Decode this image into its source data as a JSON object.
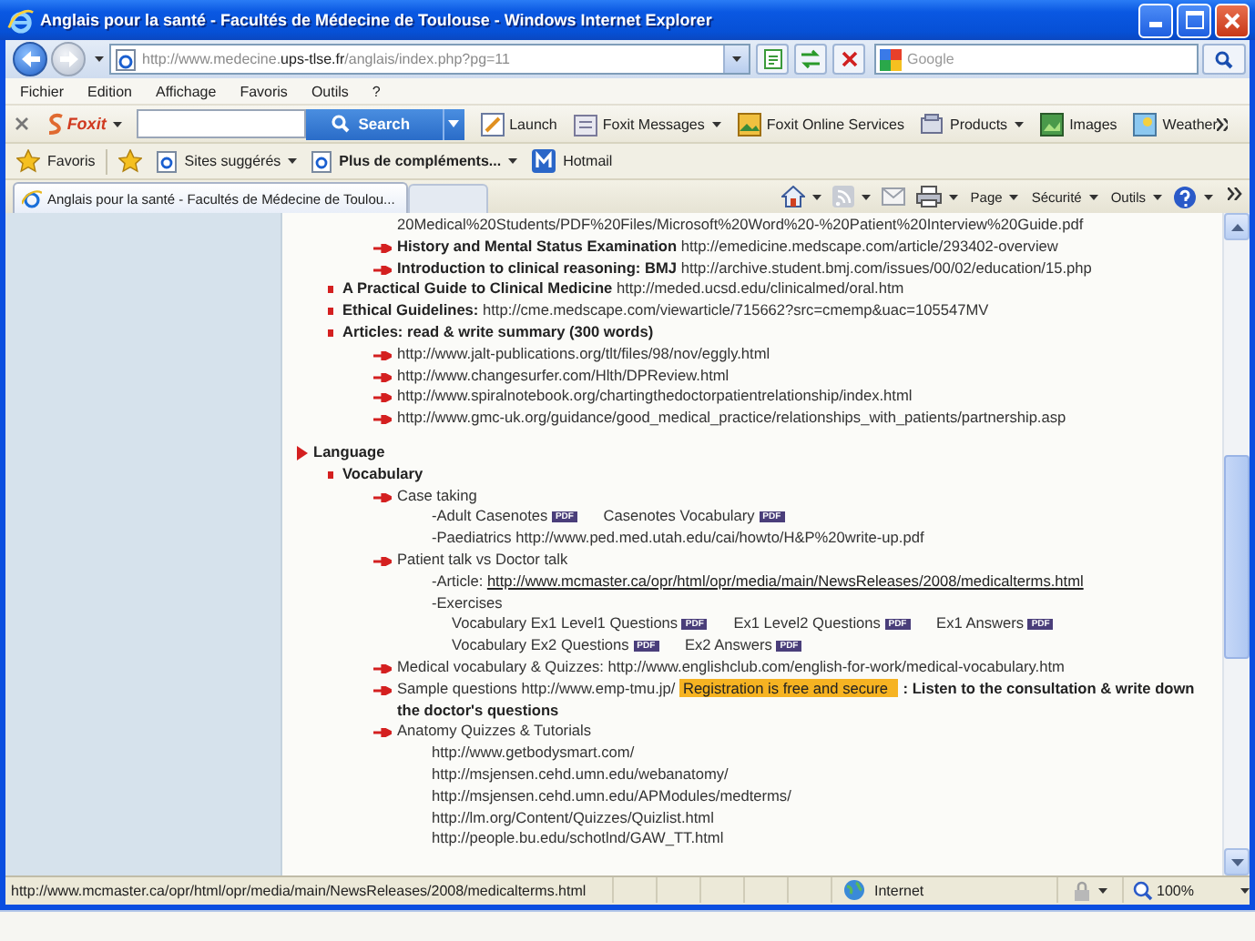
{
  "window": {
    "title": "Anglais pour la santé - Facultés de Médecine de Toulouse - Windows Internet Explorer"
  },
  "address_bar": {
    "url_parts": [
      "http://www.medecine.",
      "ups-tlse.fr",
      "/anglais/index.php?pg=11"
    ],
    "search": {
      "placeholder": "Google"
    }
  },
  "menu": [
    "Fichier",
    "Edition",
    "Affichage",
    "Favoris",
    "Outils",
    "?"
  ],
  "foxit_toolbar": {
    "brand": "Foxit",
    "search_button": "Search",
    "items": [
      {
        "label": "Launch",
        "dropdown": false
      },
      {
        "label": "Foxit Messages",
        "dropdown": true
      },
      {
        "label": "Foxit Online Services",
        "dropdown": false
      },
      {
        "label": "Products",
        "dropdown": true
      },
      {
        "label": "Images",
        "dropdown": false
      },
      {
        "label": "Weather",
        "dropdown": false
      }
    ]
  },
  "favorites_bar": {
    "favorites_button": "Favoris",
    "items": [
      {
        "label": "Sites suggérés",
        "dropdown": true,
        "bold": false
      },
      {
        "label": "Plus de compléments...",
        "dropdown": true,
        "bold": true
      },
      {
        "label": "Hotmail",
        "dropdown": false,
        "bold": false
      }
    ]
  },
  "tabs": [
    {
      "label": "Anglais pour la santé - Facultés de Médecine de Toulou...",
      "selected": true
    }
  ],
  "command_bar": {
    "items": [
      {
        "label": "Page",
        "dropdown": true
      },
      {
        "label": "Sécurité",
        "dropdown": true
      },
      {
        "label": "Outils",
        "dropdown": true
      }
    ]
  },
  "content": {
    "outline": [
      {
        "kind": "none",
        "children": [
          {
            "kind": "none",
            "children": [
              {
                "kind": "plain",
                "segments": [
                  {
                    "kind": "text",
                    "text": "20Medical%20Students/PDF%20Files/Microsoft%20Word%20-%20Patient%20Interview%20Guide.pdf"
                  }
                ]
              },
              {
                "kind": "arrow",
                "segments": [
                  {
                    "kind": "bold",
                    "text": "History and Mental Status Examination"
                  },
                  {
                    "kind": "text",
                    "text": "http://emedicine.medscape.com/article/293402-overview"
                  }
                ]
              },
              {
                "kind": "arrow",
                "segments": [
                  {
                    "kind": "bold",
                    "text": "Introduction to clinical reasoning: BMJ"
                  },
                  {
                    "kind": "text",
                    "text": "http://archive.student.bmj.com/issues/00/02/education/15.php"
                  }
                ]
              }
            ]
          },
          {
            "kind": "square",
            "segments": [
              {
                "kind": "bold",
                "text": "A Practical Guide to Clinical Medicine"
              },
              {
                "kind": "text",
                "text": "http://meded.ucsd.edu/clinicalmed/oral.htm"
              }
            ]
          },
          {
            "kind": "square",
            "segments": [
              {
                "kind": "bold",
                "text": "Ethical Guidelines:"
              },
              {
                "kind": "text",
                "text": "http://cme.medscape.com/viewarticle/715662?src=cmemp&uac=105547MV"
              }
            ]
          },
          {
            "kind": "square",
            "segments": [
              {
                "kind": "bold",
                "text": "Articles: read & write summary (300 words)"
              }
            ],
            "children": [
              {
                "kind": "arrow",
                "segments": [
                  {
                    "kind": "text",
                    "text": "http://www.jalt-publications.org/tlt/files/98/nov/eggly.html"
                  }
                ]
              },
              {
                "kind": "arrow",
                "segments": [
                  {
                    "kind": "text",
                    "text": "http://www.changesurfer.com/Hlth/DPReview.html"
                  }
                ]
              },
              {
                "kind": "arrow",
                "segments": [
                  {
                    "kind": "text",
                    "text": "http://www.spiralnotebook.org/chartingthedoctorpatientrelationship/index.html"
                  }
                ]
              },
              {
                "kind": "arrow",
                "segments": [
                  {
                    "kind": "text",
                    "text": "http://www.gmc-uk.org/guidance/good_medical_practice/relationships_with_patients/partnership.asp"
                  }
                ]
              }
            ]
          }
        ]
      },
      {
        "kind": "triangle",
        "segments": [
          {
            "kind": "bold",
            "text": "Language"
          }
        ],
        "children": [
          {
            "kind": "square",
            "segments": [
              {
                "kind": "bold",
                "text": "Vocabulary"
              }
            ],
            "children": [
              {
                "kind": "arrow",
                "segments": [
                  {
                    "kind": "text",
                    "text": "Case taking"
                  }
                ],
                "children": [
                  {
                    "kind": "plain",
                    "segments": [
                      {
                        "kind": "text",
                        "text": "-Adult Casenotes"
                      },
                      {
                        "kind": "badge",
                        "text": "PDF"
                      },
                      {
                        "kind": "text",
                        "text": "Casenotes Vocabulary"
                      },
                      {
                        "kind": "badge",
                        "text": "PDF"
                      }
                    ]
                  },
                  {
                    "kind": "plain",
                    "segments": [
                      {
                        "kind": "text",
                        "text": "-Paediatrics http://www.ped.med.utah.edu/cai/howto/H&P%20write-up.pdf"
                      }
                    ]
                  }
                ]
              },
              {
                "kind": "arrow",
                "segments": [
                  {
                    "kind": "text",
                    "text": "Patient talk vs Doctor talk"
                  }
                ],
                "children": [
                  {
                    "kind": "plain",
                    "segments": [
                      {
                        "kind": "text",
                        "text": "-Article:"
                      },
                      {
                        "kind": "link",
                        "text": "http://www.mcmaster.ca/opr/html/opr/media/main/NewsReleases/2008/medicalterms.html"
                      }
                    ]
                  },
                  {
                    "kind": "plain",
                    "segments": [
                      {
                        "kind": "text",
                        "text": "-Exercises"
                      }
                    ],
                    "children": [
                      {
                        "kind": "plain",
                        "segments": [
                          {
                            "kind": "text",
                            "text": "Vocabulary Ex1 Level1 Questions"
                          },
                          {
                            "kind": "badge",
                            "text": "PDF"
                          },
                          {
                            "kind": "text",
                            "text": "Ex1 Level2 Questions"
                          },
                          {
                            "kind": "badge",
                            "text": "PDF"
                          },
                          {
                            "kind": "text",
                            "text": "Ex1 Answers"
                          },
                          {
                            "kind": "badge",
                            "text": "PDF"
                          }
                        ]
                      },
                      {
                        "kind": "plain",
                        "segments": [
                          {
                            "kind": "text",
                            "text": "Vocabulary Ex2 Questions"
                          },
                          {
                            "kind": "badge",
                            "text": "PDF"
                          },
                          {
                            "kind": "text",
                            "text": "Ex2 Answers"
                          },
                          {
                            "kind": "badge",
                            "text": "PDF"
                          }
                        ]
                      }
                    ]
                  }
                ]
              },
              {
                "kind": "arrow",
                "segments": [
                  {
                    "kind": "text",
                    "text": "Medical vocabulary & Quizzes: http://www.englishclub.com/english-for-work/medical-vocabulary.htm"
                  }
                ]
              },
              {
                "kind": "arrow",
                "segments": [
                  {
                    "kind": "text",
                    "text": "Sample questions http://www.emp-tmu.jp/"
                  },
                  {
                    "kind": "highlight",
                    "text": "Registration is free and secure"
                  },
                  {
                    "kind": "bold",
                    "text": ": Listen to the consultation & write down"
                  },
                  {
                    "kind": "bold",
                    "text": "the doctor's questions"
                  }
                ]
              },
              {
                "kind": "arrow",
                "segments": [
                  {
                    "kind": "text",
                    "text": "Anatomy Quizzes & Tutorials"
                  }
                ],
                "children": [
                  {
                    "kind": "plain",
                    "segments": [
                      {
                        "kind": "text",
                        "text": "http://www.getbodysmart.com/"
                      }
                    ]
                  },
                  {
                    "kind": "plain",
                    "segments": [
                      {
                        "kind": "text",
                        "text": "http://msjensen.cehd.umn.edu/webanatomy/"
                      }
                    ]
                  },
                  {
                    "kind": "plain",
                    "segments": [
                      {
                        "kind": "text",
                        "text": "http://msjensen.cehd.umn.edu/APModules/medterms/"
                      }
                    ]
                  },
                  {
                    "kind": "plain",
                    "segments": [
                      {
                        "kind": "text",
                        "text": "http://lm.org/Content/Quizzes/Quizlist.html"
                      }
                    ]
                  },
                  {
                    "kind": "plain",
                    "segments": [
                      {
                        "kind": "text",
                        "text": "http://people.bu.edu/schotlnd/GAW_TT.html"
                      }
                    ]
                  }
                ]
              }
            ]
          }
        ]
      }
    ]
  },
  "status_bar": {
    "url": "http://www.mcmaster.ca/opr/html/opr/media/main/NewsReleases/2008/medicalterms.html",
    "zone": "Internet",
    "zoom": "100%"
  }
}
